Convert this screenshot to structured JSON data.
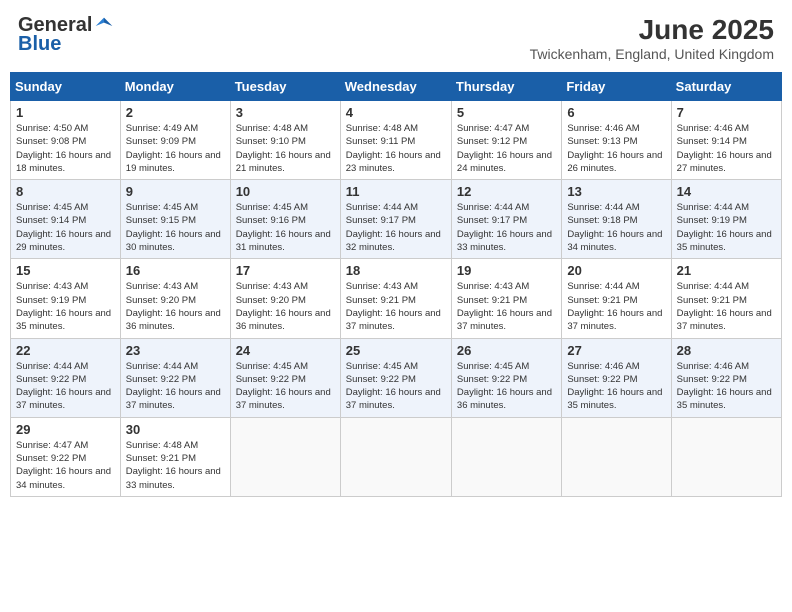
{
  "header": {
    "logo_general": "General",
    "logo_blue": "Blue",
    "month_title": "June 2025",
    "location": "Twickenham, England, United Kingdom"
  },
  "days_of_week": [
    "Sunday",
    "Monday",
    "Tuesday",
    "Wednesday",
    "Thursday",
    "Friday",
    "Saturday"
  ],
  "weeks": [
    [
      {
        "day": "1",
        "info": "Sunrise: 4:50 AM\nSunset: 9:08 PM\nDaylight: 16 hours and 18 minutes."
      },
      {
        "day": "2",
        "info": "Sunrise: 4:49 AM\nSunset: 9:09 PM\nDaylight: 16 hours and 19 minutes."
      },
      {
        "day": "3",
        "info": "Sunrise: 4:48 AM\nSunset: 9:10 PM\nDaylight: 16 hours and 21 minutes."
      },
      {
        "day": "4",
        "info": "Sunrise: 4:48 AM\nSunset: 9:11 PM\nDaylight: 16 hours and 23 minutes."
      },
      {
        "day": "5",
        "info": "Sunrise: 4:47 AM\nSunset: 9:12 PM\nDaylight: 16 hours and 24 minutes."
      },
      {
        "day": "6",
        "info": "Sunrise: 4:46 AM\nSunset: 9:13 PM\nDaylight: 16 hours and 26 minutes."
      },
      {
        "day": "7",
        "info": "Sunrise: 4:46 AM\nSunset: 9:14 PM\nDaylight: 16 hours and 27 minutes."
      }
    ],
    [
      {
        "day": "8",
        "info": "Sunrise: 4:45 AM\nSunset: 9:14 PM\nDaylight: 16 hours and 29 minutes."
      },
      {
        "day": "9",
        "info": "Sunrise: 4:45 AM\nSunset: 9:15 PM\nDaylight: 16 hours and 30 minutes."
      },
      {
        "day": "10",
        "info": "Sunrise: 4:45 AM\nSunset: 9:16 PM\nDaylight: 16 hours and 31 minutes."
      },
      {
        "day": "11",
        "info": "Sunrise: 4:44 AM\nSunset: 9:17 PM\nDaylight: 16 hours and 32 minutes."
      },
      {
        "day": "12",
        "info": "Sunrise: 4:44 AM\nSunset: 9:17 PM\nDaylight: 16 hours and 33 minutes."
      },
      {
        "day": "13",
        "info": "Sunrise: 4:44 AM\nSunset: 9:18 PM\nDaylight: 16 hours and 34 minutes."
      },
      {
        "day": "14",
        "info": "Sunrise: 4:44 AM\nSunset: 9:19 PM\nDaylight: 16 hours and 35 minutes."
      }
    ],
    [
      {
        "day": "15",
        "info": "Sunrise: 4:43 AM\nSunset: 9:19 PM\nDaylight: 16 hours and 35 minutes."
      },
      {
        "day": "16",
        "info": "Sunrise: 4:43 AM\nSunset: 9:20 PM\nDaylight: 16 hours and 36 minutes."
      },
      {
        "day": "17",
        "info": "Sunrise: 4:43 AM\nSunset: 9:20 PM\nDaylight: 16 hours and 36 minutes."
      },
      {
        "day": "18",
        "info": "Sunrise: 4:43 AM\nSunset: 9:21 PM\nDaylight: 16 hours and 37 minutes."
      },
      {
        "day": "19",
        "info": "Sunrise: 4:43 AM\nSunset: 9:21 PM\nDaylight: 16 hours and 37 minutes."
      },
      {
        "day": "20",
        "info": "Sunrise: 4:44 AM\nSunset: 9:21 PM\nDaylight: 16 hours and 37 minutes."
      },
      {
        "day": "21",
        "info": "Sunrise: 4:44 AM\nSunset: 9:21 PM\nDaylight: 16 hours and 37 minutes."
      }
    ],
    [
      {
        "day": "22",
        "info": "Sunrise: 4:44 AM\nSunset: 9:22 PM\nDaylight: 16 hours and 37 minutes."
      },
      {
        "day": "23",
        "info": "Sunrise: 4:44 AM\nSunset: 9:22 PM\nDaylight: 16 hours and 37 minutes."
      },
      {
        "day": "24",
        "info": "Sunrise: 4:45 AM\nSunset: 9:22 PM\nDaylight: 16 hours and 37 minutes."
      },
      {
        "day": "25",
        "info": "Sunrise: 4:45 AM\nSunset: 9:22 PM\nDaylight: 16 hours and 37 minutes."
      },
      {
        "day": "26",
        "info": "Sunrise: 4:45 AM\nSunset: 9:22 PM\nDaylight: 16 hours and 36 minutes."
      },
      {
        "day": "27",
        "info": "Sunrise: 4:46 AM\nSunset: 9:22 PM\nDaylight: 16 hours and 35 minutes."
      },
      {
        "day": "28",
        "info": "Sunrise: 4:46 AM\nSunset: 9:22 PM\nDaylight: 16 hours and 35 minutes."
      }
    ],
    [
      {
        "day": "29",
        "info": "Sunrise: 4:47 AM\nSunset: 9:22 PM\nDaylight: 16 hours and 34 minutes."
      },
      {
        "day": "30",
        "info": "Sunrise: 4:48 AM\nSunset: 9:21 PM\nDaylight: 16 hours and 33 minutes."
      },
      {
        "day": "",
        "info": ""
      },
      {
        "day": "",
        "info": ""
      },
      {
        "day": "",
        "info": ""
      },
      {
        "day": "",
        "info": ""
      },
      {
        "day": "",
        "info": ""
      }
    ]
  ]
}
